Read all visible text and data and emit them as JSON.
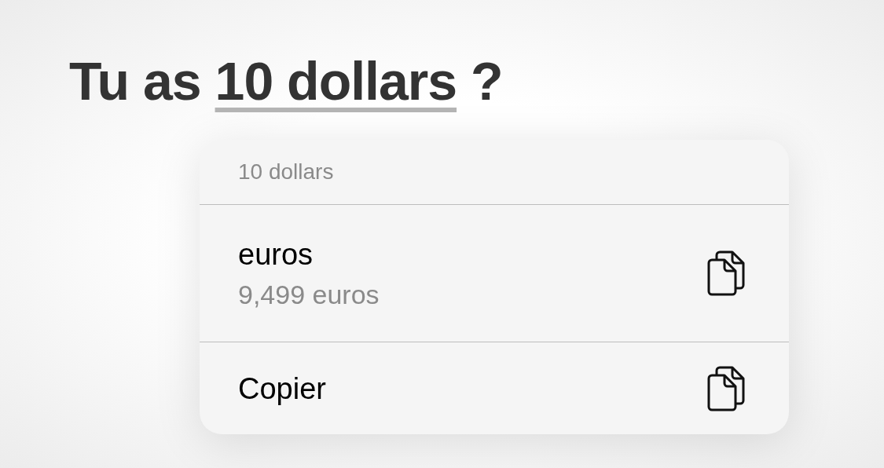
{
  "heading": {
    "before": "Tu as",
    "highlighted": "10 dollars",
    "after": "?"
  },
  "menu": {
    "header": "10 dollars",
    "items": [
      {
        "kind": "conversion",
        "title": "euros",
        "subtitle": "9,499 euros"
      },
      {
        "kind": "action",
        "title": "Copier"
      }
    ]
  }
}
